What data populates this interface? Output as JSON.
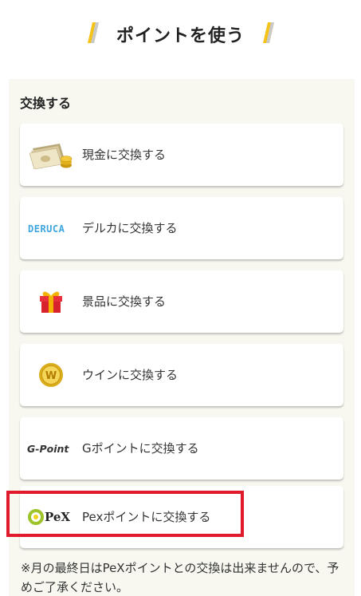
{
  "header": {
    "title": "ポイントを使う",
    "accent_colors": [
      "#f5c218",
      "#c9c9c9"
    ]
  },
  "section": {
    "title": "交換する"
  },
  "options": [
    {
      "label": "現金に交換する",
      "icon": "cash-icon"
    },
    {
      "label": "デルカに交換する",
      "icon": "deruca-logo",
      "logo_text": "DERUCA"
    },
    {
      "label": "景品に交換する",
      "icon": "gift-icon"
    },
    {
      "label": "ウインに交換する",
      "icon": "win-coin-icon",
      "icon_text": "W"
    },
    {
      "label": "Gポイントに交換する",
      "icon": "gpoint-logo",
      "logo_text": "G-Point"
    },
    {
      "label": "Pexポイントに交換する",
      "icon": "pex-logo",
      "logo_text": "PeX",
      "highlighted": true
    }
  ],
  "note": "※月の最終日はPeXポイントとの交換は出来ませんので、予めご了承ください。",
  "colors": {
    "panel_bg": "#f8f8f1",
    "highlight_border": "#e01a2a"
  }
}
